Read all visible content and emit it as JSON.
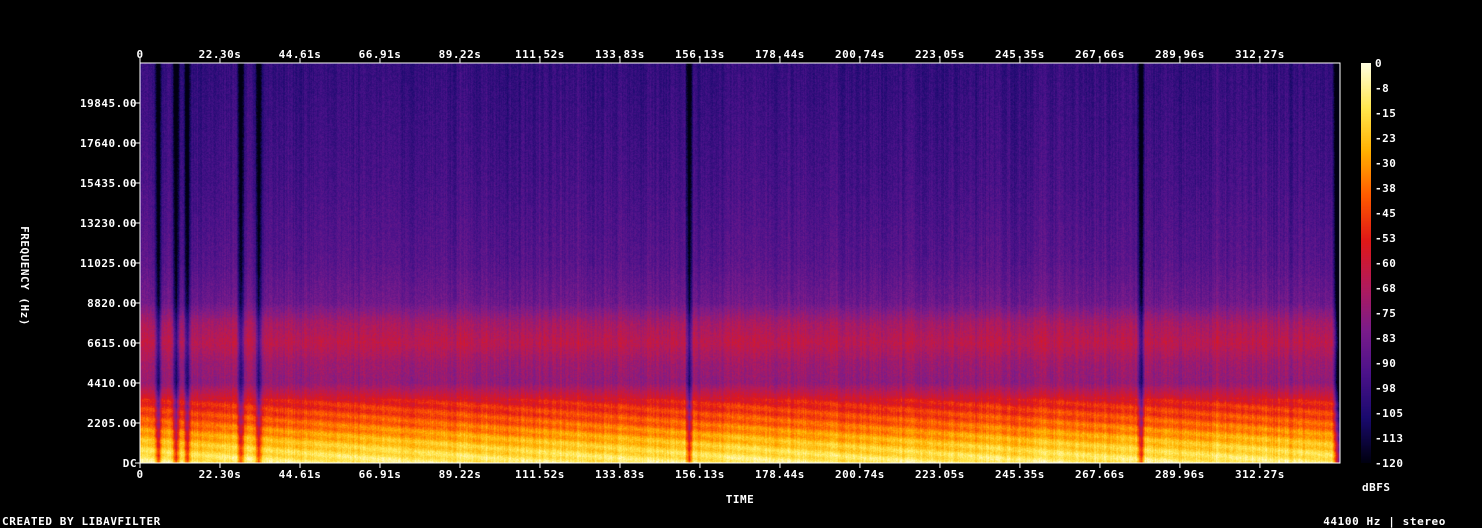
{
  "chart_data": {
    "type": "heatmap",
    "title": "",
    "xlabel": "TIME",
    "ylabel": "FREQUENCY (Hz)",
    "x_ticks": [
      "0",
      "22.30s",
      "44.61s",
      "66.91s",
      "89.22s",
      "111.52s",
      "133.83s",
      "156.13s",
      "178.44s",
      "200.74s",
      "223.05s",
      "245.35s",
      "267.66s",
      "289.96s",
      "312.27s"
    ],
    "x_tick_values": [
      0,
      22.3,
      44.61,
      66.91,
      89.22,
      111.52,
      133.83,
      156.13,
      178.44,
      200.74,
      223.05,
      245.35,
      267.66,
      289.96,
      312.27
    ],
    "xlim": [
      0,
      334.6
    ],
    "y_ticks": [
      "DC",
      "2205.00",
      "4410.00",
      "6615.00",
      "8820.00",
      "11025.00",
      "13230.00",
      "15435.00",
      "17640.00",
      "19845.00"
    ],
    "y_tick_values": [
      0,
      2205,
      4410,
      6615,
      8820,
      11025,
      13230,
      15435,
      17640,
      19845
    ],
    "ylim": [
      0,
      22050
    ],
    "colorbar": {
      "label": "dBFS",
      "ticks": [
        "0",
        "-8",
        "-15",
        "-23",
        "-30",
        "-38",
        "-45",
        "-53",
        "-60",
        "-68",
        "-75",
        "-83",
        "-90",
        "-98",
        "-105",
        "-113",
        "-120"
      ],
      "range": [
        -120,
        0
      ],
      "colors": [
        "#000010",
        "#1a0a6e",
        "#4b128a",
        "#7c1c8a",
        "#b41a5a",
        "#e01818",
        "#ff5a00",
        "#ffb000",
        "#ffe850",
        "#ffffe0"
      ]
    },
    "dark_events_s": [
      5,
      10,
      13,
      28,
      33,
      153,
      279
    ],
    "level_profile_dbfs": [
      {
        "hz": 0,
        "db": -10
      },
      {
        "hz": 1000,
        "db": -22
      },
      {
        "hz": 2205,
        "db": -40
      },
      {
        "hz": 3300,
        "db": -52
      },
      {
        "hz": 4410,
        "db": -75
      },
      {
        "hz": 5500,
        "db": -72
      },
      {
        "hz": 6615,
        "db": -64
      },
      {
        "hz": 7700,
        "db": -70
      },
      {
        "hz": 8820,
        "db": -84
      },
      {
        "hz": 11025,
        "db": -90
      },
      {
        "hz": 15435,
        "db": -95
      },
      {
        "hz": 22050,
        "db": -100
      }
    ]
  },
  "footer": {
    "credit": "CREATED BY LIBAVFILTER",
    "sample_rate": "44100 Hz | stereo"
  }
}
